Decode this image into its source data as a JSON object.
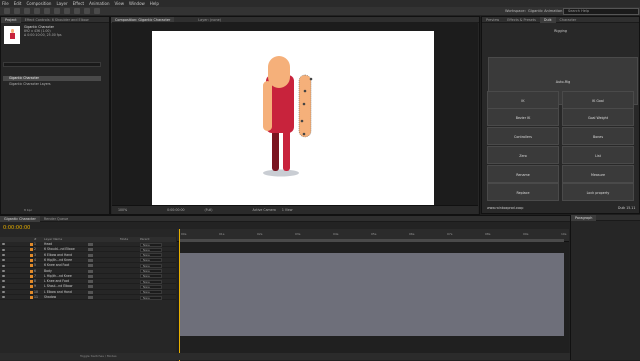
{
  "menu": [
    "File",
    "Edit",
    "Composition",
    "Layer",
    "Effect",
    "Animation",
    "View",
    "Window",
    "Help"
  ],
  "workspace": {
    "label": "Workspace:",
    "value": "Gigantic Animation"
  },
  "search_placeholder": "Search Help",
  "project": {
    "tabs": [
      "Project",
      "Effect Controls: 6 Shoulder and Elbow"
    ],
    "info_name": "Gigantic Character",
    "info_lines": [
      "892 x 436 (1.00)",
      "Δ 0:00:10:00, 25.00 fps"
    ],
    "items": [
      "Gigantic Character",
      "Gigantic Character Layers"
    ],
    "bpc": "8 bpc"
  },
  "comp": {
    "tabs": [
      "Composition: Gigantic Character",
      "Layer: (none)"
    ],
    "subtab": "Gigantic Character",
    "zoom": "100%",
    "timecode": "0:00:00:00",
    "resolution": "(Full)",
    "camera": "Active Camera",
    "views": "1 View"
  },
  "right": {
    "tabs": [
      "Preview",
      "Effects & Presets",
      "Duik",
      "Character"
    ],
    "title": "Rigging",
    "autorig": "Auto-Rig",
    "buttons": [
      [
        "IK",
        "IK Goal"
      ],
      [
        "Bezier IK",
        "Goal Weight"
      ],
      [
        "Controllers",
        "Bones"
      ],
      [
        "Zero",
        "List"
      ],
      [
        "Rename",
        "Measure"
      ],
      [
        "Replace",
        "Lock property"
      ]
    ],
    "url": "www.rainboxprod.coop",
    "version": "Duik 15.11"
  },
  "timeline": {
    "tabs": [
      "Gigantic Character",
      "Render Queue"
    ],
    "timecode": "0:00:00:00",
    "frames": "00000 (25.00 fps)",
    "columns": [
      "#",
      "Layer Name",
      "Mode",
      "Parent"
    ],
    "ruler": [
      "00s",
      "01s",
      "02s",
      "03s",
      "04s",
      "05s",
      "06s",
      "07s",
      "08s",
      "09s",
      "10s"
    ],
    "layers": [
      {
        "n": "1",
        "name": "Head"
      },
      {
        "n": "2",
        "name": "6 Should...nd Elbow"
      },
      {
        "n": "3",
        "name": "6 Elbow and Hand"
      },
      {
        "n": "4",
        "name": "6 Hip/th...nd Knee"
      },
      {
        "n": "5",
        "name": "6 Knee and Foot"
      },
      {
        "n": "6",
        "name": "Body"
      },
      {
        "n": "7",
        "name": "L Hip/th...nd Knee"
      },
      {
        "n": "8",
        "name": "L Knee and Foot"
      },
      {
        "n": "9",
        "name": "L Shoul...nd Elbow"
      },
      {
        "n": "10",
        "name": "L Elbow and Hand"
      },
      {
        "n": "11",
        "name": "Shadow"
      }
    ],
    "parent_value": "None",
    "paragraph_tab": "Paragraph",
    "bottom_status": "Toggle Switches / Modes"
  },
  "colors": {
    "accent": "#e8b000",
    "skin": "#f5b07a",
    "red": "#c8233c",
    "dark_red": "#7a1420",
    "shadow": "#c9cdd3",
    "layer_label": "#e08a2a"
  }
}
